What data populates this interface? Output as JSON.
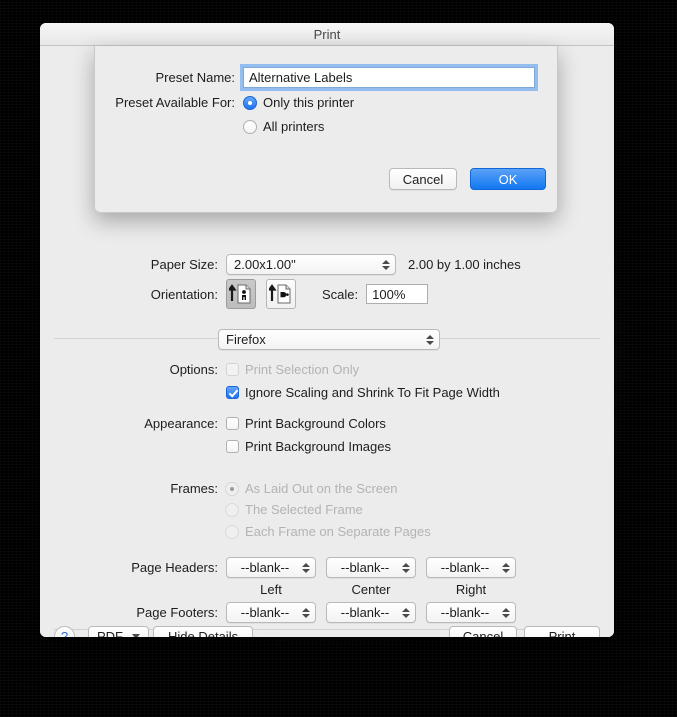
{
  "window": {
    "title": "Print"
  },
  "sheet": {
    "preset_name_label": "Preset Name:",
    "preset_name_value": "Alternative Labels",
    "available_for_label": "Preset Available For:",
    "option_only_this_printer": "Only this printer",
    "option_all_printers": "All printers",
    "cancel_label": "Cancel",
    "ok_label": "OK"
  },
  "main": {
    "paper_size_label": "Paper Size:",
    "paper_size_value": "2.00x1.00\"",
    "paper_size_note": "2.00 by 1.00 inches",
    "orientation_label": "Orientation:",
    "scale_label": "Scale:",
    "scale_value": "100%",
    "app_popup_value": "Firefox",
    "options_label": "Options:",
    "option_print_selection_only": "Print Selection Only",
    "option_ignore_scaling": "Ignore Scaling and Shrink To Fit Page Width",
    "appearance_label": "Appearance:",
    "option_bg_colors": "Print Background Colors",
    "option_bg_images": "Print Background Images",
    "frames_label": "Frames:",
    "frames_as_laid_out": "As Laid Out on the Screen",
    "frames_selected_frame": "The Selected Frame",
    "frames_separate_pages": "Each Frame on Separate Pages",
    "page_headers_label": "Page Headers:",
    "page_footers_label": "Page Footers:",
    "blank_value": "--blank--",
    "col_left": "Left",
    "col_center": "Center",
    "col_right": "Right"
  },
  "footer": {
    "help_label": "?",
    "pdf_label": "PDF",
    "hide_details_label": "Hide Details",
    "cancel_label": "Cancel",
    "print_label": "Print"
  },
  "colors": {
    "accent_blue": "#1f72ef",
    "window_bg": "#ececec",
    "disabled_text": "#b3b3b3"
  }
}
